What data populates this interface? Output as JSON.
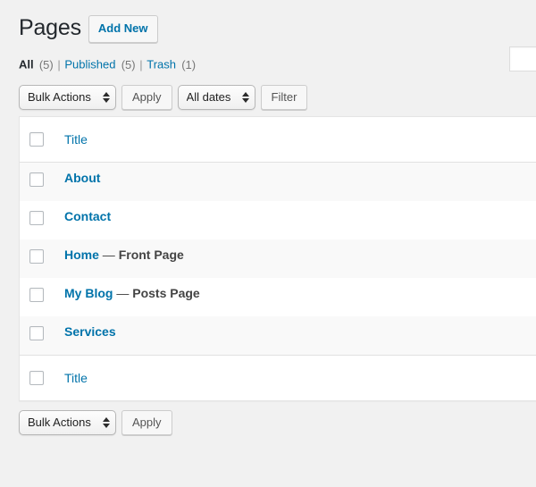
{
  "header": {
    "title": "Pages",
    "add_new_label": "Add New"
  },
  "views": [
    {
      "label": "All",
      "count": "(5)",
      "current": true
    },
    {
      "label": "Published",
      "count": "(5)",
      "current": false
    },
    {
      "label": "Trash",
      "count": "(1)",
      "current": false
    }
  ],
  "view_separator": "|",
  "search": {
    "value": "",
    "placeholder": ""
  },
  "tablenav_top": {
    "bulk_actions_label": "Bulk Actions",
    "apply_label": "Apply",
    "dates_label": "All dates",
    "filter_label": "Filter"
  },
  "tablenav_bottom": {
    "bulk_actions_label": "Bulk Actions",
    "apply_label": "Apply"
  },
  "table": {
    "column_title": "Title",
    "footer_column_title": "Title",
    "rows": [
      {
        "title": "About",
        "state": "",
        "alternate": true
      },
      {
        "title": "Contact",
        "state": "",
        "alternate": false
      },
      {
        "title": "Home",
        "state": "Front Page",
        "alternate": true
      },
      {
        "title": "My Blog",
        "state": "Posts Page",
        "alternate": false
      },
      {
        "title": "Services",
        "state": "",
        "alternate": true
      }
    ],
    "state_dash": "—"
  },
  "colors": {
    "link": "#0073aa",
    "heading": "#23282d",
    "page_background": "#f1f1f1",
    "row_alternate": "#f9f9f9",
    "border": "#e5e5e5"
  }
}
